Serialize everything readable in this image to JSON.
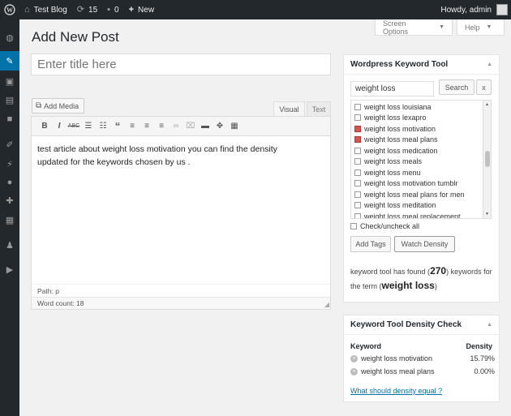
{
  "adminbar": {
    "site_name": "Test Blog",
    "updates_count": "15",
    "comments_count": "0",
    "new_label": "New",
    "greeting": "Howdy, admin"
  },
  "screen_options": {
    "label": "Screen Options",
    "help_label": "Help"
  },
  "page": {
    "title": "Add New Post"
  },
  "post": {
    "title_placeholder": "Enter title here",
    "add_media_label": "Add Media",
    "tab_visual": "Visual",
    "tab_text": "Text",
    "content": "test article about weight loss motivation you can find the density updated for the keywords chosen by us .",
    "path": "Path: p",
    "word_count": "Word count: 18"
  },
  "toolbar_icons": [
    "bold-icon",
    "italic-icon",
    "strikethrough-icon",
    "bullet-list-icon",
    "numbered-list-icon",
    "blockquote-icon",
    "align-left-icon",
    "align-center-icon",
    "align-right-icon",
    "link-icon",
    "unlink-icon",
    "read-more-icon",
    "fullscreen-icon",
    "kitchen-sink-icon"
  ],
  "keyword_tool": {
    "title": "Wordpress Keyword Tool",
    "search_value": "weight loss",
    "search_label": "Search",
    "clear_label": "x",
    "suggestions": [
      {
        "label": "weight loss louisiana",
        "checked": false
      },
      {
        "label": "weight loss lexapro",
        "checked": false
      },
      {
        "label": "weight loss motivation",
        "checked": true
      },
      {
        "label": "weight loss meal plans",
        "checked": true
      },
      {
        "label": "weight loss medication",
        "checked": false
      },
      {
        "label": "weight loss meals",
        "checked": false
      },
      {
        "label": "weight loss menu",
        "checked": false
      },
      {
        "label": "weight loss motivation tumblr",
        "checked": false
      },
      {
        "label": "weight loss meal plans for men",
        "checked": false
      },
      {
        "label": "weight loss meditation",
        "checked": false
      },
      {
        "label": "weight loss meal replacement",
        "checked": false
      }
    ],
    "check_all_label": "Check/uncheck all",
    "add_tags_label": "Add Tags",
    "watch_density_label": "Watch Density",
    "found_prefix": "keyword tool has found (",
    "found_count": "270",
    "found_middle": ") keywords for the term (",
    "found_term": "weight loss",
    "found_suffix": ")"
  },
  "density": {
    "title": "Keyword Tool Density Check",
    "col_keyword": "Keyword",
    "col_density": "Density",
    "rows": [
      {
        "keyword": "weight loss motivation",
        "density": "15.79%"
      },
      {
        "keyword": "weight loss meal plans",
        "density": "0.00%"
      }
    ],
    "help_link": "What should density equal ?"
  }
}
